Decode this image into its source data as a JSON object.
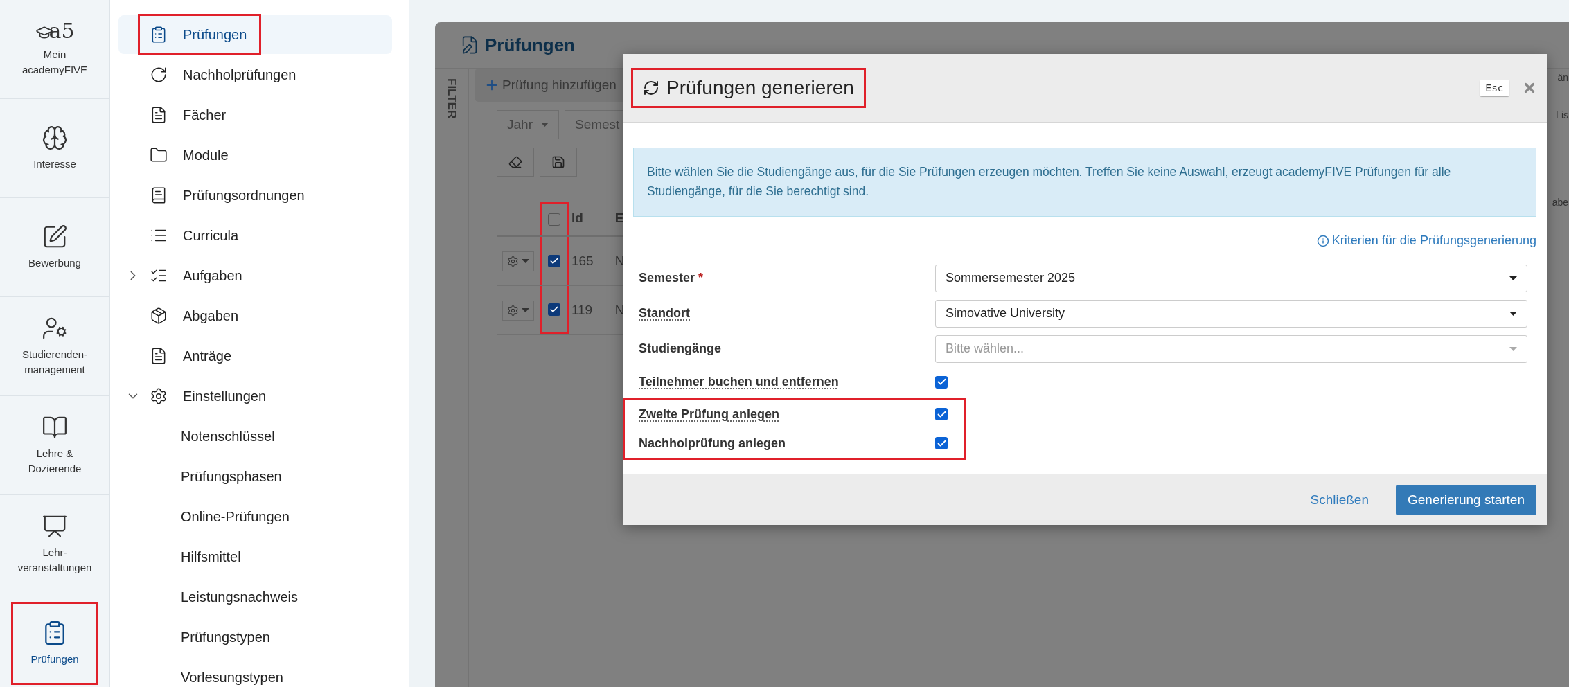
{
  "rail": [
    {
      "label": "Mein\nacademyFIVE",
      "logo_text": "a5",
      "selected": false,
      "highlighted": false
    },
    {
      "label": "Interesse",
      "selected": false,
      "highlighted": false
    },
    {
      "label": "Bewerbung",
      "selected": false,
      "highlighted": false
    },
    {
      "label": "Studierenden-\nmanagement",
      "selected": false,
      "highlighted": false
    },
    {
      "label": "Lehre &\nDozierende",
      "selected": false,
      "highlighted": false
    },
    {
      "label": "Lehr-\nveranstaltungen",
      "selected": false,
      "highlighted": false
    },
    {
      "label": "Prüfungen",
      "selected": true,
      "highlighted": true
    }
  ],
  "sidebar": {
    "items": [
      {
        "label": "Prüfungen",
        "selected": true,
        "highlighted": true
      },
      {
        "label": "Nachholprüfungen",
        "selected": false,
        "highlighted": false
      },
      {
        "label": "Fächer",
        "selected": false,
        "highlighted": false
      },
      {
        "label": "Module",
        "selected": false,
        "highlighted": false
      },
      {
        "label": "Prüfungsordnungen",
        "selected": false,
        "highlighted": false
      },
      {
        "label": "Curricula",
        "selected": false,
        "highlighted": false
      },
      {
        "label": "Aufgaben",
        "selected": false,
        "highlighted": false,
        "expanded": false
      },
      {
        "label": "Abgaben",
        "selected": false,
        "highlighted": false
      },
      {
        "label": "Anträge",
        "selected": false,
        "highlighted": false
      },
      {
        "label": "Einstellungen",
        "selected": false,
        "highlighted": false,
        "expanded": true,
        "children": [
          {
            "label": "Notenschlüssel",
            "selected": false
          },
          {
            "label": "Prüfungsphasen",
            "selected": false
          },
          {
            "label": "Online-Prüfungen",
            "selected": false
          },
          {
            "label": "Hilfsmittel",
            "selected": false
          },
          {
            "label": "Leistungsnachweis",
            "selected": false
          },
          {
            "label": "Prüfungstypen",
            "selected": false
          },
          {
            "label": "Vorlesungstypen",
            "selected": false
          }
        ]
      }
    ]
  },
  "panel": {
    "title": "Prüfungen",
    "filter_label": "FILTER",
    "add_button": "Prüfung hinzufügen",
    "filters": [
      "Jahr",
      "Semest"
    ],
    "table": {
      "select_column_highlighted": true,
      "header_checked": false,
      "columns": [
        "Id",
        "E"
      ],
      "rows": [
        {
          "checked": true,
          "id": "165",
          "column_2": "N"
        },
        {
          "checked": true,
          "id": "119",
          "column_2": "N"
        }
      ]
    },
    "fragments": [
      "än",
      "Lis",
      "abe"
    ]
  },
  "modal": {
    "title": "Prüfungen generieren",
    "esc_key": "Esc",
    "info": "Bitte wählen Sie die Studiengänge aus, für die Sie Prüfungen erzeugen möchten. Treffen Sie keine Auswahl, erzeugt academyFIVE Prüfungen für alle Studiengänge, für die Sie berechtigt sind.",
    "link": "Kriterien für die Prüfungsgenerierung",
    "fields": [
      {
        "kind": "select",
        "label": "Semester",
        "required_mark": "*",
        "underlined": false,
        "value": "Sommersemester 2025",
        "highlighted": false
      },
      {
        "kind": "select",
        "label": "Standort",
        "underlined": true,
        "value": "Simovative University",
        "highlighted": false
      },
      {
        "kind": "select",
        "label": "Studiengänge",
        "underlined": false,
        "placeholder": "Bitte wählen...",
        "highlighted": false
      },
      {
        "kind": "checkbox",
        "label": "Teilnehmer buchen und entfernen",
        "underlined": true,
        "checked": true,
        "highlighted": false
      },
      {
        "kind": "checkbox",
        "label": "Zweite Prüfung anlegen",
        "underlined": true,
        "checked": true,
        "highlighted": true
      },
      {
        "kind": "checkbox",
        "label": "Nachholprüfung anlegen",
        "underlined": false,
        "checked": true,
        "highlighted": true
      }
    ],
    "buttons": [
      {
        "kind": "link",
        "label": "Schließen"
      },
      {
        "kind": "primary",
        "label": "Generierung starten"
      }
    ]
  }
}
